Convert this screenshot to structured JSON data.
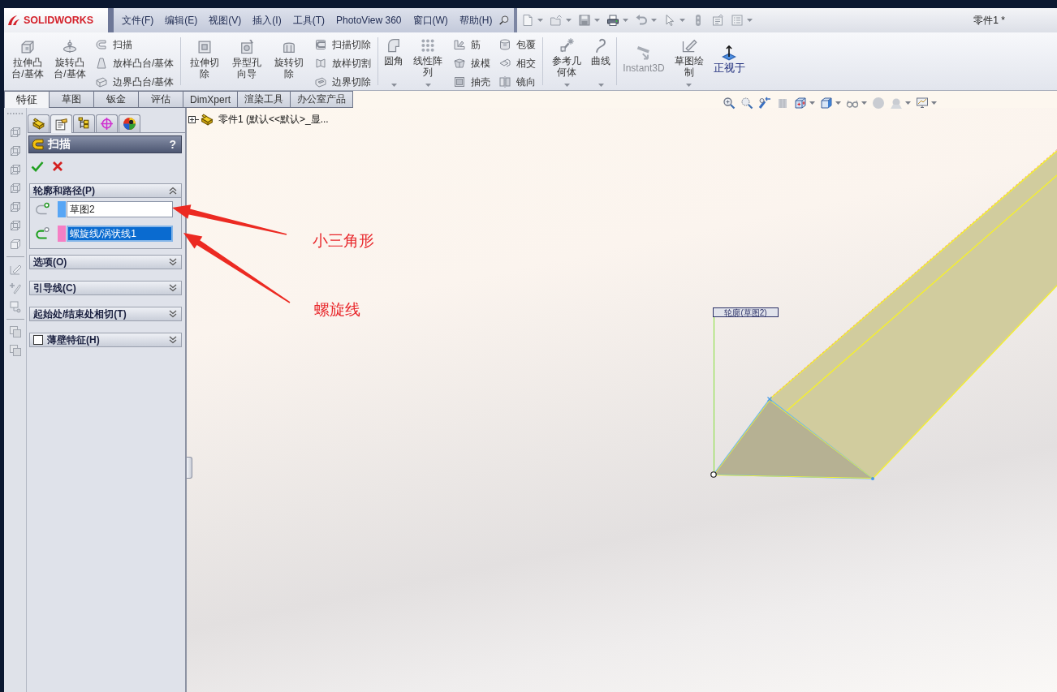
{
  "app": {
    "logo": "SOLIDWORKS",
    "menu": [
      "文件(F)",
      "编辑(E)",
      "视图(V)",
      "插入(I)",
      "工具(T)",
      "PhotoView 360",
      "窗口(W)",
      "帮助(H)"
    ],
    "document_title": "零件1 *"
  },
  "ribbon": {
    "groups": [
      {
        "items": [
          {
            "kind": "large",
            "label": "拉伸凸台/基体",
            "dropdown": false,
            "disabled": false,
            "highlighted": false
          },
          {
            "kind": "large",
            "label": "旋转凸台/基体",
            "dropdown": false,
            "disabled": false,
            "highlighted": false
          },
          {
            "kind": "stack",
            "items": [
              {
                "label": "扫描"
              },
              {
                "label": "放样凸台/基体"
              },
              {
                "label": "边界凸台/基体"
              }
            ]
          }
        ]
      },
      {
        "items": [
          {
            "kind": "large",
            "label": "拉伸切除",
            "dropdown": false,
            "disabled": false,
            "highlighted": false
          },
          {
            "kind": "large",
            "label": "异型孔向导",
            "dropdown": false,
            "disabled": false,
            "highlighted": false
          },
          {
            "kind": "large",
            "label": "旋转切除",
            "dropdown": false,
            "disabled": false,
            "highlighted": false
          },
          {
            "kind": "stack",
            "items": [
              {
                "label": "扫描切除"
              },
              {
                "label": "放样切割"
              },
              {
                "label": "边界切除"
              }
            ]
          }
        ]
      },
      {
        "items": [
          {
            "kind": "large",
            "label": "圆角",
            "dropdown": true,
            "disabled": false,
            "highlighted": false
          },
          {
            "kind": "large",
            "label": "线性阵列",
            "dropdown": true,
            "disabled": false,
            "highlighted": false
          },
          {
            "kind": "stack",
            "items": [
              {
                "label": "筋"
              },
              {
                "label": "拔模"
              },
              {
                "label": "抽壳"
              }
            ]
          },
          {
            "kind": "stack",
            "items": [
              {
                "label": "包覆"
              },
              {
                "label": "相交"
              },
              {
                "label": "镜向"
              }
            ]
          }
        ]
      },
      {
        "items": [
          {
            "kind": "large",
            "label": "参考几何体",
            "dropdown": true,
            "disabled": false,
            "highlighted": false
          },
          {
            "kind": "large",
            "label": "曲线",
            "dropdown": true,
            "disabled": false,
            "highlighted": false
          }
        ]
      },
      {
        "items": [
          {
            "kind": "large",
            "label": "Instant3D",
            "dropdown": false,
            "disabled": true,
            "highlighted": false
          },
          {
            "kind": "large",
            "label": "草图绘制",
            "dropdown": true,
            "disabled": false,
            "highlighted": false
          },
          {
            "kind": "large",
            "label": "正视于",
            "dropdown": false,
            "disabled": false,
            "highlighted": true
          }
        ]
      }
    ]
  },
  "command_tabs": [
    {
      "label": "特征",
      "selected": true
    },
    {
      "label": "草图",
      "selected": false
    },
    {
      "label": "钣金",
      "selected": false
    },
    {
      "label": "评估",
      "selected": false
    },
    {
      "label": "DimXpert",
      "selected": false
    },
    {
      "label": "渲染工具",
      "selected": false
    },
    {
      "label": "办公室产品",
      "selected": false
    }
  ],
  "panel": {
    "tabs": [
      {
        "selected": false
      },
      {
        "selected": true
      },
      {
        "selected": false
      },
      {
        "selected": false
      },
      {
        "selected": false
      }
    ],
    "title": "扫描",
    "help": "?",
    "sections": [
      {
        "kind": "group",
        "title": "轮廓和路径(P)",
        "expanded": true,
        "fields": [
          {
            "kind": "profile",
            "value": "草图2",
            "color": "#58a6f5",
            "selected": false
          },
          {
            "kind": "path",
            "value": "螺旋线/涡状线1",
            "color": "#f57fc4",
            "selected": true
          }
        ]
      },
      {
        "kind": "group",
        "title": "选项(O)",
        "expanded": false
      },
      {
        "kind": "group",
        "title": "引导线(C)",
        "expanded": false
      },
      {
        "kind": "group",
        "title": "起始处/结束处相切(T)",
        "expanded": false
      },
      {
        "kind": "checkbox",
        "title": "薄壁特征(H)",
        "expanded": false,
        "checked": false
      }
    ]
  },
  "feature_tree": {
    "root": {
      "label": "零件1 (默认<<默认>_显...",
      "expanded": false
    }
  },
  "viewport": {
    "callout": "轮廓(草图2)"
  },
  "annotations": [
    {
      "text": "小三角形"
    },
    {
      "text": "螺旋线"
    }
  ]
}
